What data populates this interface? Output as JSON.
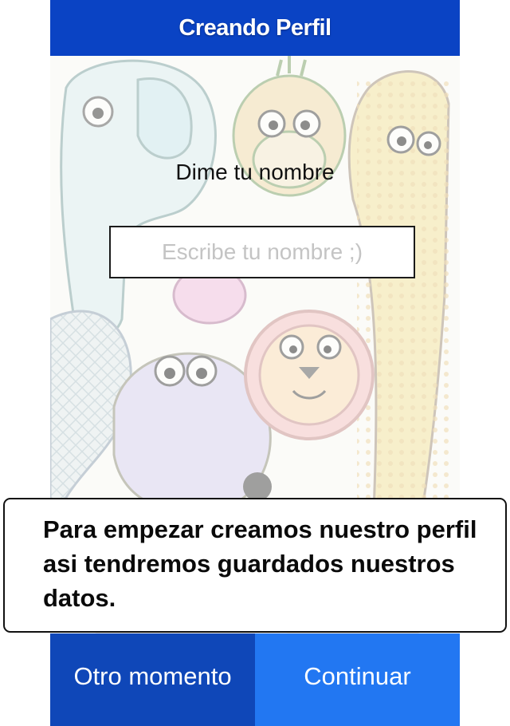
{
  "header": {
    "title": "Creando Perfil"
  },
  "form": {
    "prompt": "Dime tu nombre",
    "name_value": "",
    "name_placeholder": "Escribe tu nombre ;)"
  },
  "info": {
    "message": "Para empezar creamos nuestro perfil asi tendremos guardados nuestros datos."
  },
  "buttons": {
    "later_label": "Otro momento",
    "continue_label": "Continuar"
  },
  "colors": {
    "header_bg": "#0a43c4",
    "later_bg": "#0f47b8",
    "continue_bg": "#2277f2",
    "page_bg": "#ffffff"
  }
}
